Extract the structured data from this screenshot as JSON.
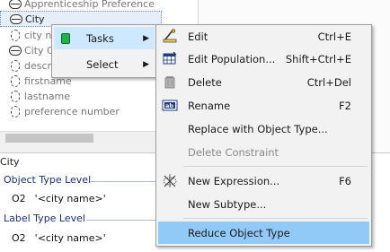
{
  "tree": {
    "items": [
      {
        "label": "Apprenticeship Preference",
        "kind": "entity"
      },
      {
        "label": "City",
        "kind": "entity"
      },
      {
        "label": "city n",
        "kind": "value"
      },
      {
        "label": "City C",
        "kind": "entity"
      },
      {
        "label": "descr",
        "kind": "value"
      },
      {
        "label": "firstname",
        "kind": "value"
      },
      {
        "label": "lastname",
        "kind": "value"
      },
      {
        "label": "preference number",
        "kind": "value"
      }
    ]
  },
  "verbalization": {
    "title": "City",
    "sections": [
      {
        "heading": "Object Type Level",
        "reading": {
          "id": "O2",
          "text": "'<city name>'"
        }
      },
      {
        "heading": "Label Type Level",
        "reading": {
          "id": "O2",
          "text": "'<city name>'"
        }
      }
    ]
  },
  "context_menu": {
    "items": [
      {
        "label": "Tasks",
        "has_submenu": true,
        "icon": "tasks-icon"
      },
      {
        "label": "Select",
        "has_submenu": true
      }
    ]
  },
  "tasks_menu": {
    "items": [
      {
        "label": "Edit",
        "shortcut": "Ctrl+E",
        "icon": "edit-icon"
      },
      {
        "label": "Edit Population...",
        "shortcut": "Shift+Ctrl+E",
        "icon": "population-table-icon"
      },
      {
        "label": "Delete",
        "shortcut": "Ctrl+Del",
        "icon": "trash-icon"
      },
      {
        "label": "Rename",
        "shortcut": "F2",
        "icon": "rename-icon"
      },
      {
        "label": "Replace with Object Type...",
        "shortcut": ""
      },
      {
        "label": "Delete Constraint",
        "shortcut": "",
        "disabled": true
      },
      {
        "label": "New Expression...",
        "shortcut": "F6",
        "icon": "expression-icon"
      },
      {
        "label": "New Subtype...",
        "shortcut": ""
      },
      {
        "label": "Reduce Object Type",
        "shortcut": "",
        "highlighted": true
      }
    ]
  },
  "colors": {
    "menu_highlight": "#91c9f7",
    "section_heading": "#1b2e7a",
    "task_icon_green": "#23b14d"
  }
}
